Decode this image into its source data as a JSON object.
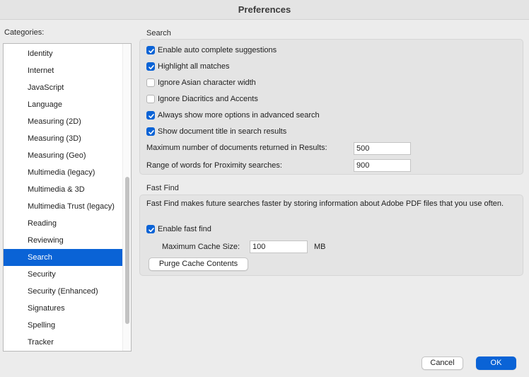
{
  "window": {
    "title": "Preferences"
  },
  "categories": {
    "label": "Categories:",
    "items": [
      "Identity",
      "Internet",
      "JavaScript",
      "Language",
      "Measuring (2D)",
      "Measuring (3D)",
      "Measuring (Geo)",
      "Multimedia (legacy)",
      "Multimedia & 3D",
      "Multimedia Trust (legacy)",
      "Reading",
      "Reviewing",
      "Search",
      "Security",
      "Security (Enhanced)",
      "Signatures",
      "Spelling",
      "Tracker"
    ],
    "selected": "Search"
  },
  "search": {
    "title": "Search",
    "options": [
      {
        "label": "Enable auto complete suggestions",
        "checked": true
      },
      {
        "label": "Highlight all matches",
        "checked": true
      },
      {
        "label": "Ignore Asian character width",
        "checked": false
      },
      {
        "label": "Ignore Diacritics and Accents",
        "checked": false
      },
      {
        "label": "Always show more options in advanced search",
        "checked": true
      },
      {
        "label": "Show document title in search results",
        "checked": true
      }
    ],
    "max_docs_label": "Maximum number of documents returned in Results:",
    "max_docs_value": "500",
    "proximity_label": "Range of words for Proximity searches:",
    "proximity_value": "900"
  },
  "fast_find": {
    "title": "Fast Find",
    "description": "Fast Find makes future searches faster by storing information about Adobe PDF files that you use often.",
    "enable_label": "Enable fast find",
    "enable_checked": true,
    "cache_size_label": "Maximum Cache Size:",
    "cache_size_value": "100",
    "cache_size_unit": "MB",
    "purge_label": "Purge Cache Contents"
  },
  "footer": {
    "cancel_label": "Cancel",
    "ok_label": "OK"
  },
  "colors": {
    "accent": "#0a63d6",
    "window_bg": "#ececec",
    "group_bg": "#e4e4e4"
  }
}
